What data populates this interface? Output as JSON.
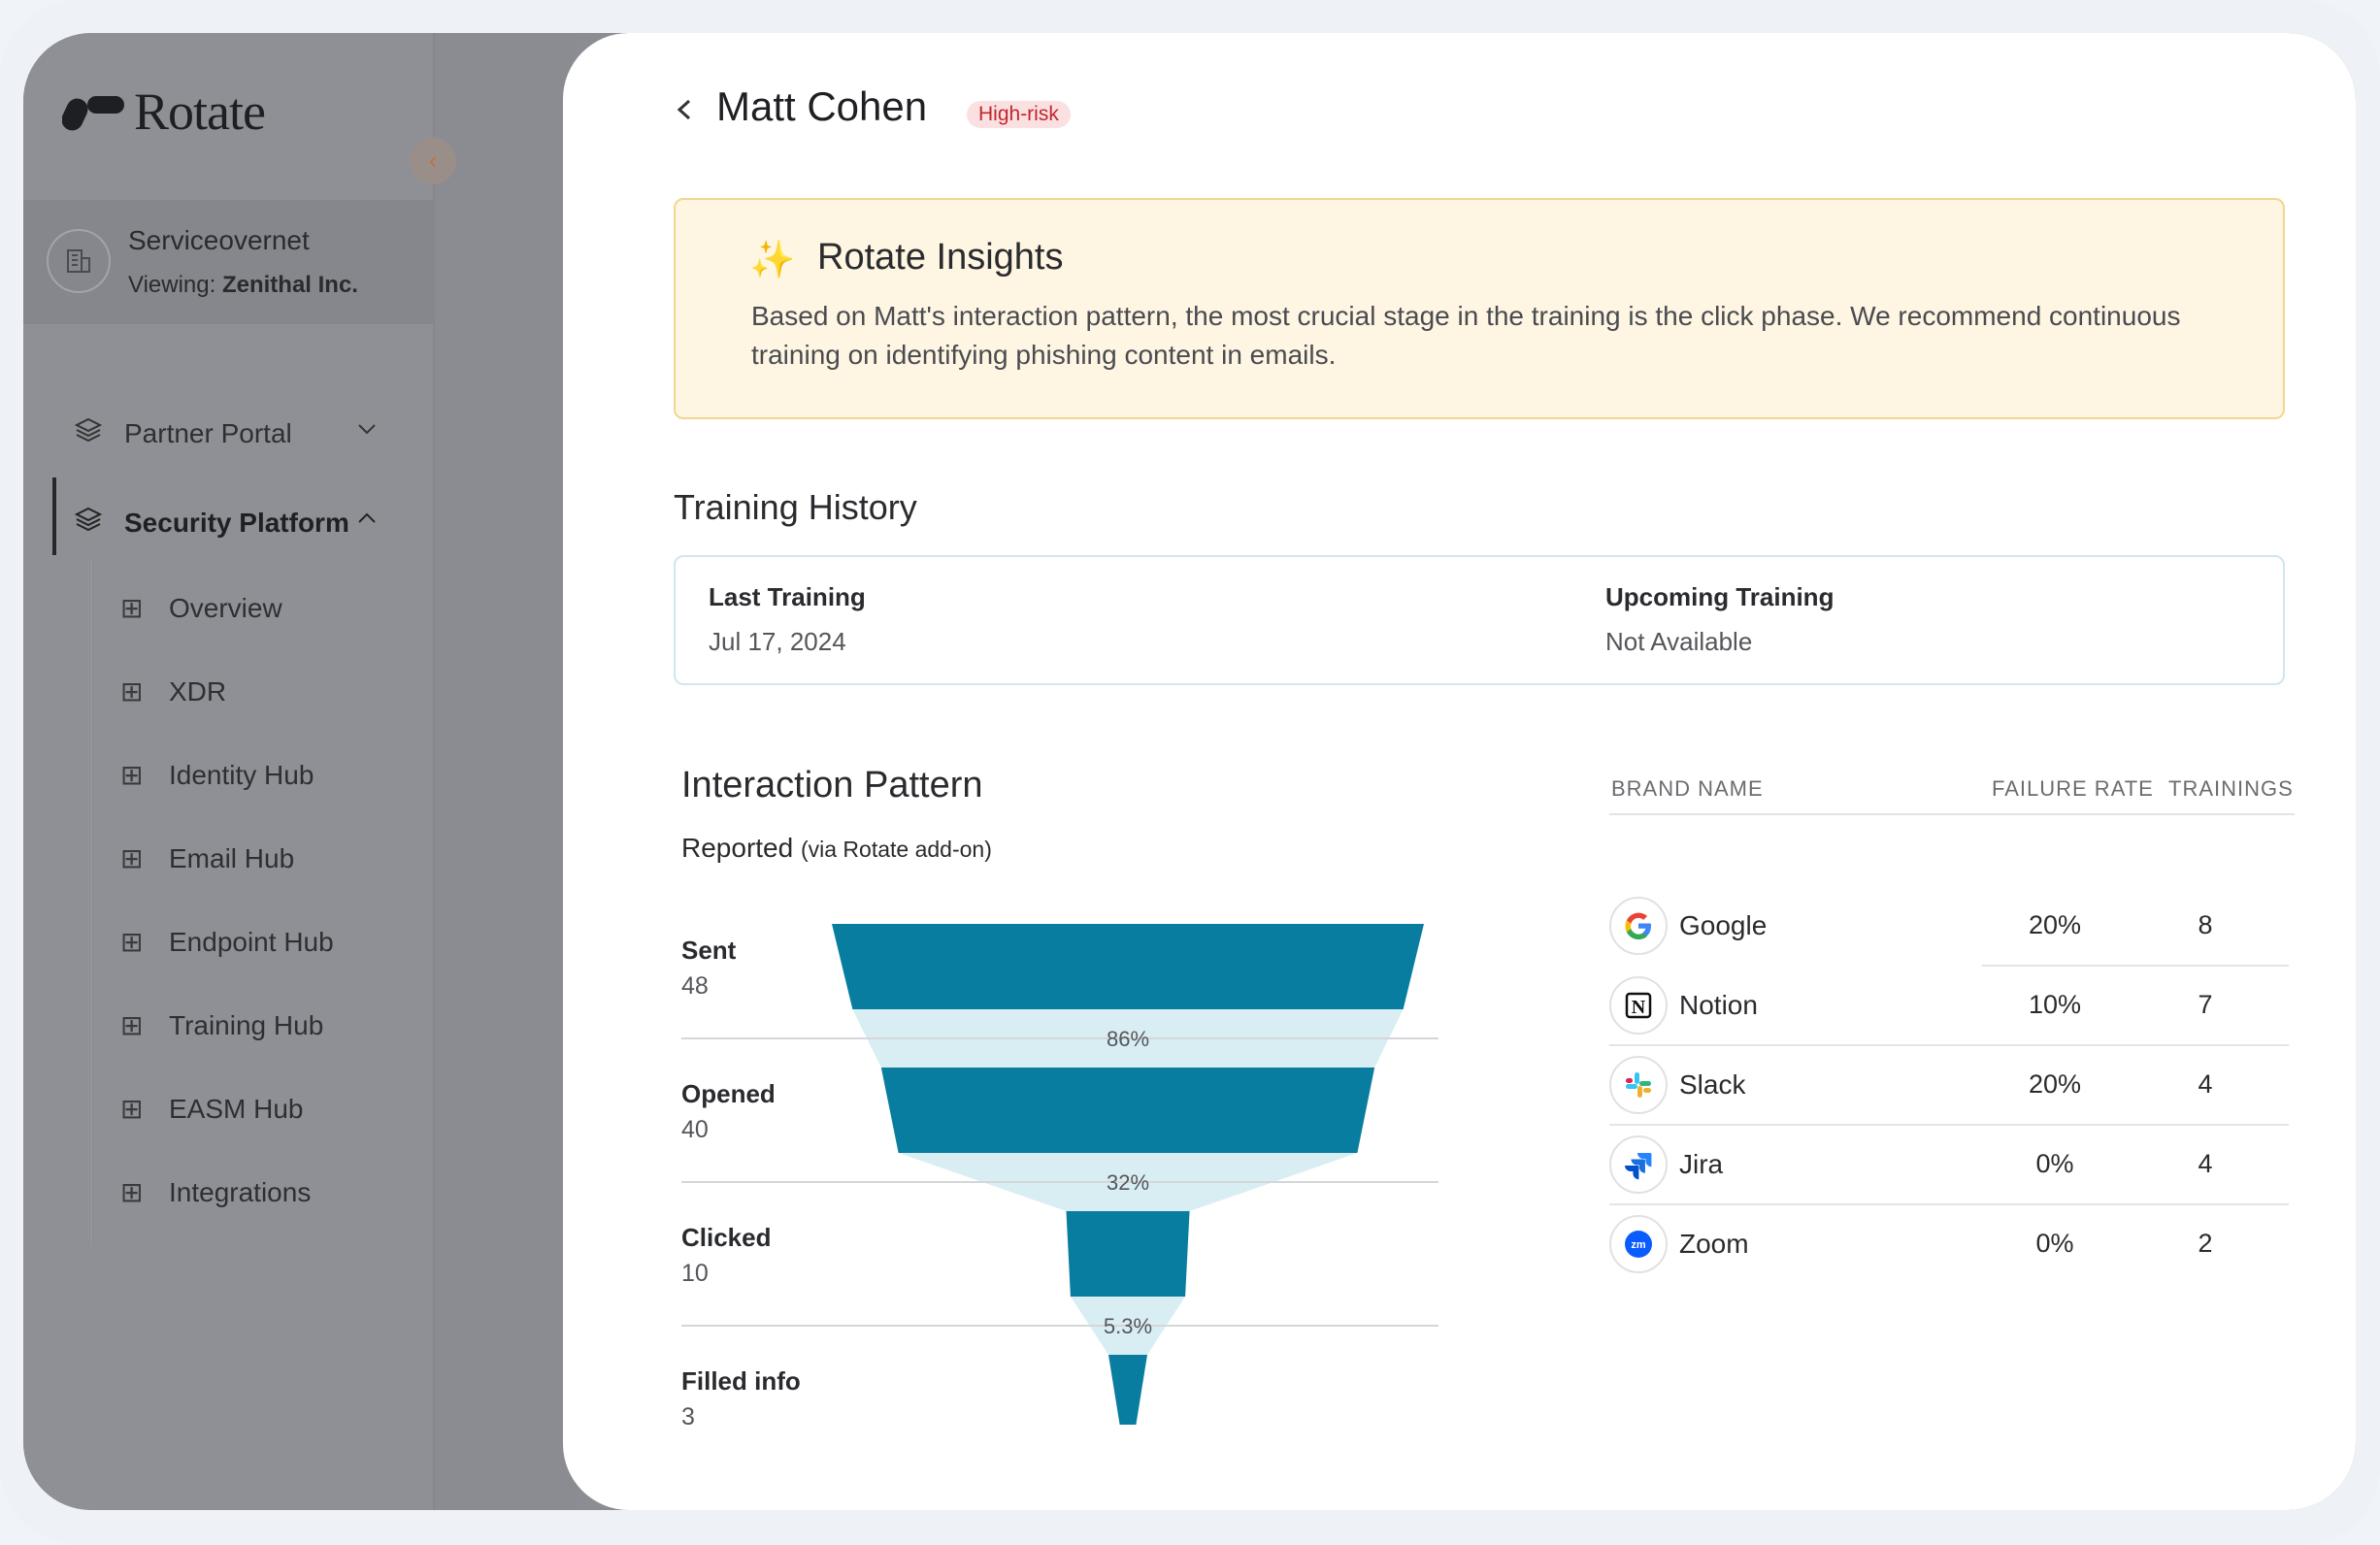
{
  "app": {
    "logo_text": "Rotate"
  },
  "tenant": {
    "name": "Serviceovernet",
    "viewing_label": "Viewing:",
    "viewing_org": "Zenithal Inc."
  },
  "nav": {
    "partner_portal": "Partner Portal",
    "security_platform": "Security Platform",
    "items": [
      {
        "label": "Overview"
      },
      {
        "label": "XDR"
      },
      {
        "label": "Identity Hub"
      },
      {
        "label": "Email Hub"
      },
      {
        "label": "Endpoint Hub"
      },
      {
        "label": "Training Hub"
      },
      {
        "label": "EASM Hub"
      },
      {
        "label": "Integrations"
      }
    ]
  },
  "person": {
    "name": "Matt Cohen",
    "risk": "High-risk"
  },
  "insights": {
    "title": "Rotate Insights",
    "body": "Based on Matt's interaction pattern, the most crucial stage in the training is the click phase. We recommend continuous training on identifying phishing content in emails."
  },
  "training_history": {
    "title": "Training History",
    "last_label": "Last Training",
    "last_value": "Jul 17, 2024",
    "upcoming_label": "Upcoming Training",
    "upcoming_value": "Not Available"
  },
  "interaction": {
    "title": "Interaction Pattern",
    "subtitle": "Reported",
    "subtitle_note": "(via Rotate add-on)",
    "stages": [
      {
        "label": "Sent",
        "value": 48
      },
      {
        "label": "Opened",
        "value": 40
      },
      {
        "label": "Clicked",
        "value": 10
      },
      {
        "label": "Filled info",
        "value": 3
      }
    ],
    "conversions": [
      "86%",
      "32%",
      "5.3%"
    ],
    "colors": {
      "bar": "#087d9f",
      "connector": "#d9eef3"
    }
  },
  "brands": {
    "headers": {
      "name": "BRAND NAME",
      "rate": "FAILURE RATE",
      "trainings": "TRAININGS"
    },
    "rows": [
      {
        "name": "Google",
        "rate": "20%",
        "trainings": "8",
        "icon": "google-icon"
      },
      {
        "name": "Notion",
        "rate": "10%",
        "trainings": "7",
        "icon": "notion-icon"
      },
      {
        "name": "Slack",
        "rate": "20%",
        "trainings": "4",
        "icon": "slack-icon"
      },
      {
        "name": "Jira",
        "rate": "0%",
        "trainings": "4",
        "icon": "jira-icon"
      },
      {
        "name": "Zoom",
        "rate": "0%",
        "trainings": "2",
        "icon": "zoom-icon"
      }
    ]
  }
}
